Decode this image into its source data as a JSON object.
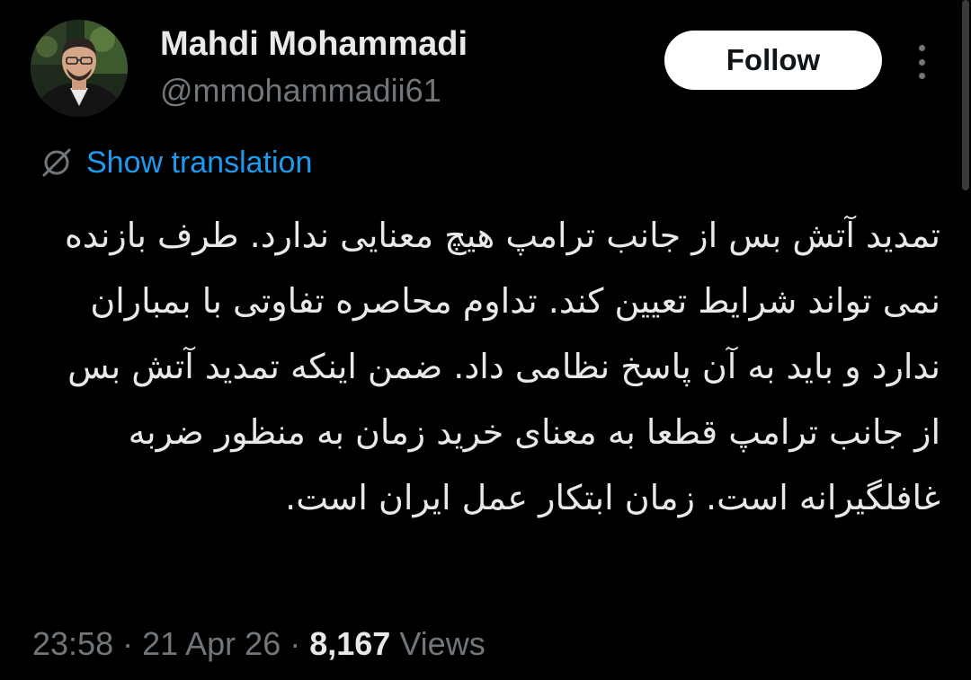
{
  "user": {
    "display_name": "Mahdi Mohammadi",
    "handle": "@mmohammadii61"
  },
  "follow_button": {
    "label": "Follow"
  },
  "translation": {
    "label": "Show translation",
    "icon": "globe-slash-icon"
  },
  "tweet": {
    "text": "تمدید آتش بس از جانب ترامپ هیچ معنایی ندارد. طرف بازنده نمی تواند شرایط تعیین کند. تداوم محاصره تفاوتی با بمباران ندارد و باید به آن پاسخ نظامی داد. ضمن اینکه تمدید آتش بس از جانب ترامپ قطعا به معنای خرید زمان به منظور ضربه غافلگیرانه است. زمان ابتکار عمل ایران است."
  },
  "meta": {
    "time": "23:58",
    "separator": "·",
    "date": "21 Apr 26",
    "views_count": "8,167",
    "views_label": "Views"
  },
  "colors": {
    "background": "#000000",
    "text_primary": "#e7e9ea",
    "text_secondary": "#71767b",
    "link": "#1d9bf0",
    "button_bg": "#ffffff"
  }
}
